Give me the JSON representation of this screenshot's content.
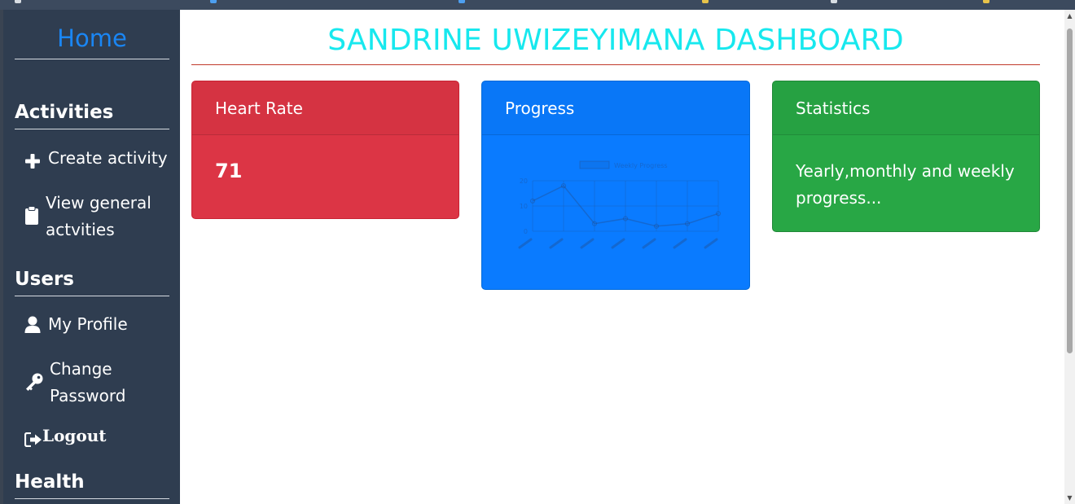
{
  "sidebar": {
    "home": "Home",
    "sections": {
      "activities": "Activities",
      "users": "Users",
      "health": "Health"
    },
    "items": {
      "create_activity": "Create activity",
      "view_general_line1": "View general",
      "view_general_line2": "actvities",
      "my_profile": "My Profile",
      "change_password_line1": "Change",
      "change_password_line2": "Password",
      "logout": "Logout"
    },
    "icons": [
      "plus-icon",
      "clipboard-icon",
      "user-icon",
      "key-icon",
      "sign-out-icon"
    ]
  },
  "main": {
    "title": "SANDRINE UWIZEYIMANA DASHBOARD",
    "cards": {
      "heart_rate": {
        "header": "Heart Rate",
        "value": "71"
      },
      "progress": {
        "header": "Progress"
      },
      "statistics": {
        "header": "Statistics",
        "text": "Yearly,monthly and weekly progress..."
      }
    }
  },
  "colors": {
    "title": "#17e8ee",
    "home_link": "#1a86f4",
    "sidebar_bg": "#2f3d50",
    "card_red": "#dc3545",
    "card_blue": "#0a7bff",
    "card_green": "#28a745",
    "title_rule": "#c0392b"
  },
  "chart_data": {
    "type": "line",
    "title": "",
    "series": [
      {
        "name": "Weekly Progress",
        "values": [
          12,
          18,
          3,
          5,
          2,
          3,
          7
        ]
      }
    ],
    "categories": [
      "",
      "",
      "",
      "",
      "",
      "",
      ""
    ],
    "ylim": [
      0,
      20
    ],
    "yticks": [
      "0",
      "10",
      "20"
    ],
    "grid": true,
    "legend": "top"
  }
}
